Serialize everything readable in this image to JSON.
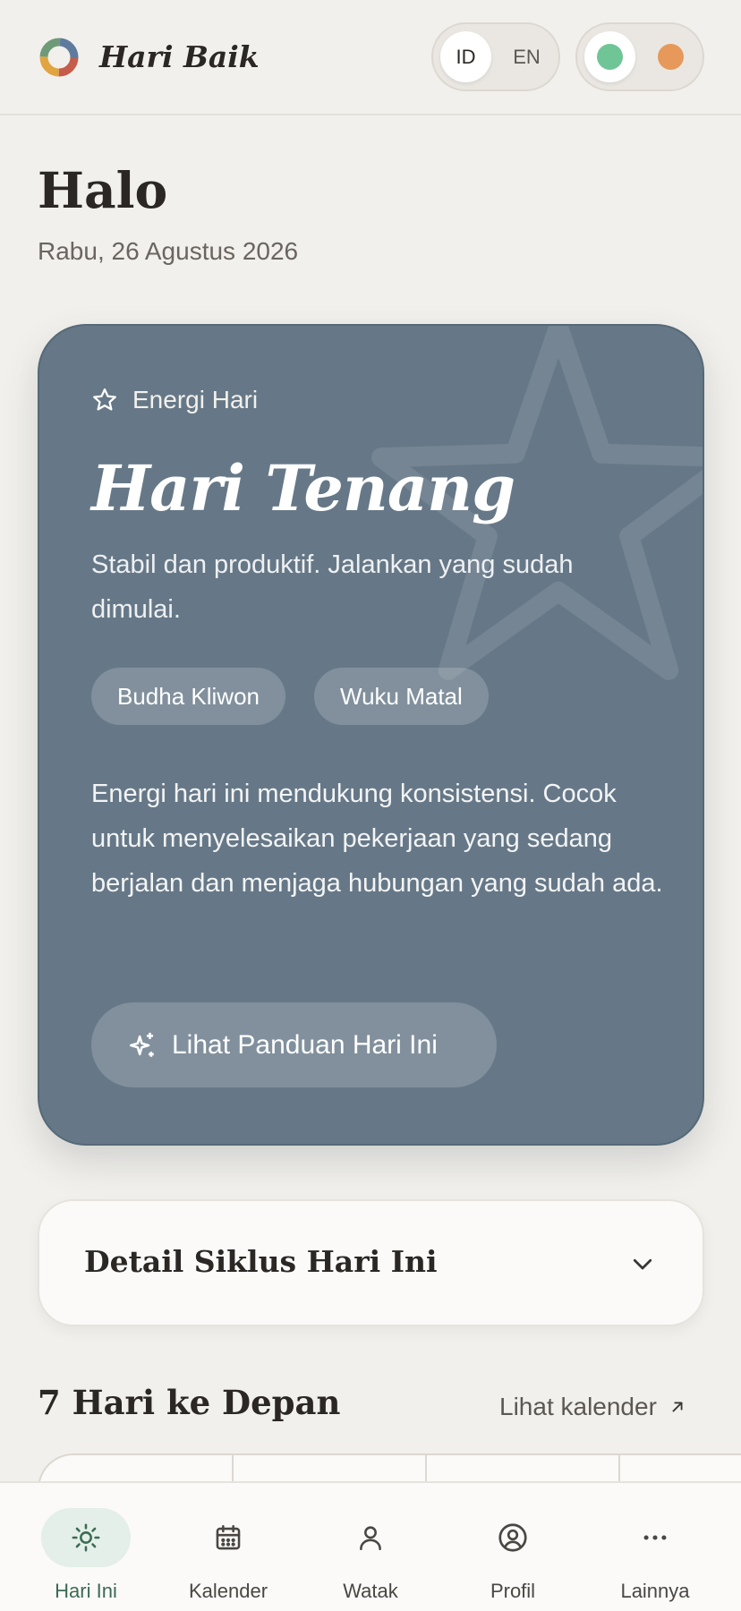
{
  "header": {
    "app_title": "Hari Baik",
    "lang_options": [
      "ID",
      "EN"
    ],
    "lang_selected": "ID",
    "theme_colors": [
      "#6fc596",
      "#e6995a"
    ]
  },
  "greeting": {
    "title": "Halo",
    "date": "Rabu, 26 Agustus 2026"
  },
  "energy_card": {
    "eyebrow": "Energi Hari",
    "title": "Hari Tenang",
    "subtitle": "Stabil dan produktif. Jalankan yang sudah dimulai.",
    "tags": [
      "Budha Kliwon",
      "Wuku Matal"
    ],
    "description": "Energi hari ini mendukung konsistensi. Cocok untuk menyelesaikan pekerjaan yang sedang berjalan dan menjaga hubungan yang sudah ada.",
    "button_label": "Lihat Panduan Hari Ini",
    "background_color": "#667887"
  },
  "detail": {
    "title": "Detail Siklus Hari Ini"
  },
  "week": {
    "title": "7 Hari ke Depan",
    "link_label": "Lihat kalender"
  },
  "bottom_nav": {
    "items": [
      {
        "label": "Hari Ini",
        "icon": "sun-icon"
      },
      {
        "label": "Kalender",
        "icon": "calendar-icon"
      },
      {
        "label": "Watak",
        "icon": "person-icon"
      },
      {
        "label": "Profil",
        "icon": "profile-circle-icon"
      },
      {
        "label": "Lainnya",
        "icon": "more-dots-icon"
      }
    ],
    "active": "Hari Ini"
  }
}
